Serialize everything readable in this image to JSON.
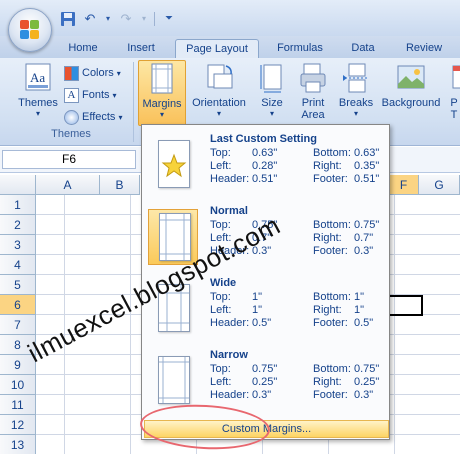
{
  "qat": {
    "save_icon": "save-icon",
    "undo_icon": "undo-icon",
    "redo_icon": "redo-icon",
    "customize_icon": "customize-qat-icon"
  },
  "tabs": [
    {
      "label": "Home"
    },
    {
      "label": "Insert"
    },
    {
      "label": "Page Layout",
      "active": true
    },
    {
      "label": "Formulas"
    },
    {
      "label": "Data"
    },
    {
      "label": "Review"
    }
  ],
  "ribbon": {
    "themes_group": {
      "themes_label": "Themes",
      "colors_label": "Colors",
      "fonts_label": "Fonts",
      "effects_label": "Effects",
      "group_label": "Themes"
    },
    "page_setup": {
      "margins_label": "Margins",
      "orientation_label": "Orientation",
      "size_label": "Size",
      "print_area_label": "Print Area",
      "breaks_label": "Breaks",
      "background_label": "Background",
      "partial_label": "P T"
    }
  },
  "formula_bar": {
    "name_box": "F6"
  },
  "columns": [
    "A",
    "B",
    "F",
    "G"
  ],
  "rows": [
    "1",
    "2",
    "3",
    "4",
    "5",
    "6",
    "7",
    "8",
    "9",
    "10",
    "11",
    "12",
    "13"
  ],
  "margins_menu": {
    "options": [
      {
        "title": "Last Custom Setting",
        "top_label": "Top:",
        "top": "0.63\"",
        "bottom_label": "Bottom:",
        "bottom": "0.63\"",
        "left_label": "Left:",
        "left": "0.28\"",
        "right_label": "Right:",
        "right": "0.35\"",
        "header_label": "Header:",
        "header": "0.51\"",
        "footer_label": "Footer:",
        "footer": "0.51\""
      },
      {
        "title": "Normal",
        "top_label": "Top:",
        "top": "0.75\"",
        "bottom_label": "Bottom:",
        "bottom": "0.75\"",
        "left_label": "Left:",
        "left": "0.7\"",
        "right_label": "Right:",
        "right": "0.7\"",
        "header_label": "Header:",
        "header": "0.3\"",
        "footer_label": "Footer:",
        "footer": "0.3\""
      },
      {
        "title": "Wide",
        "top_label": "Top:",
        "top": "1\"",
        "bottom_label": "Bottom:",
        "bottom": "1\"",
        "left_label": "Left:",
        "left": "1\"",
        "right_label": "Right:",
        "right": "1\"",
        "header_label": "Header:",
        "header": "0.5\"",
        "footer_label": "Footer:",
        "footer": "0.5\""
      },
      {
        "title": "Narrow",
        "top_label": "Top:",
        "top": "0.75\"",
        "bottom_label": "Bottom:",
        "bottom": "0.75\"",
        "left_label": "Left:",
        "left": "0.25\"",
        "right_label": "Right:",
        "right": "0.25\"",
        "header_label": "Header:",
        "header": "0.3\"",
        "footer_label": "Footer:",
        "footer": "0.3\""
      }
    ],
    "custom_margins_label": "Custom Margins..."
  },
  "watermark": "ilmuexcel.blogspot.com",
  "colors": {
    "accent_highlight": "#fbd483",
    "annotation_circle": "#e8676f"
  }
}
